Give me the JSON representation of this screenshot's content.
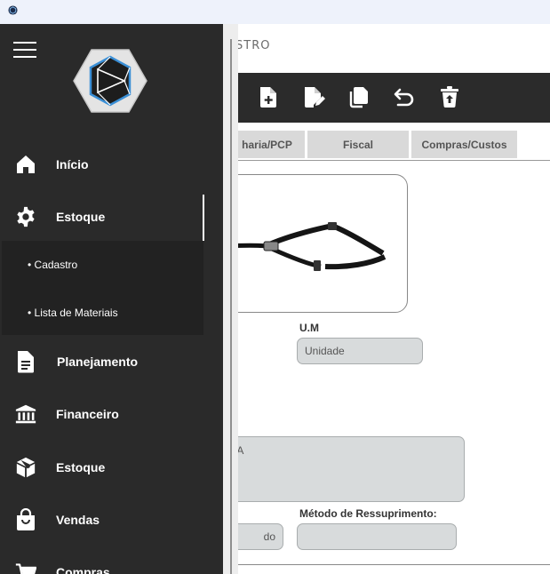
{
  "window": {
    "app_icon": "app-logo-icon"
  },
  "page": {
    "title": "STRO"
  },
  "toolbar": {
    "buttons": [
      {
        "name": "new-document-button",
        "icon": "file-plus-icon"
      },
      {
        "name": "edit-document-button",
        "icon": "file-edit-icon"
      },
      {
        "name": "copy-document-button",
        "icon": "copy-icon"
      },
      {
        "name": "undo-button",
        "icon": "undo-icon"
      },
      {
        "name": "delete-button",
        "icon": "trash-icon"
      }
    ]
  },
  "tabs": [
    {
      "label": "haria/PCP"
    },
    {
      "label": "Fiscal"
    },
    {
      "label": "Compras/Custos"
    }
  ],
  "form": {
    "um_label": "U.M",
    "um_value": "Unidade",
    "description_value": "NHA",
    "partial_value": "do",
    "metodo_label": "Método de Ressuprimento:",
    "metodo_value": ""
  },
  "drawer": {
    "menu_icon": "hamburger-menu-icon",
    "logo": "company-hexagon-logo",
    "items": [
      {
        "label": "Início",
        "icon": "home-icon"
      },
      {
        "label": "Estoque",
        "icon": "gear-icon"
      },
      {
        "label": "Planejamento",
        "icon": "document-icon"
      },
      {
        "label": "Financeiro",
        "icon": "bank-icon"
      },
      {
        "label": "Estoque",
        "icon": "package-icon"
      },
      {
        "label": "Vendas",
        "icon": "shopping-bag-icon"
      },
      {
        "label": "Compras",
        "icon": "cart-icon"
      }
    ],
    "submenu": [
      {
        "label": "• Cadastro"
      },
      {
        "label": "• Lista de Materiais"
      }
    ]
  },
  "colors": {
    "drawer_bg": "#2a2a2a",
    "submenu_bg": "#222222",
    "toolbar_bg": "#2b2b2b",
    "field_bg": "#d8dbdc",
    "tab_bg": "#d9d9d9",
    "logo_accent": "#3a8fd6"
  }
}
